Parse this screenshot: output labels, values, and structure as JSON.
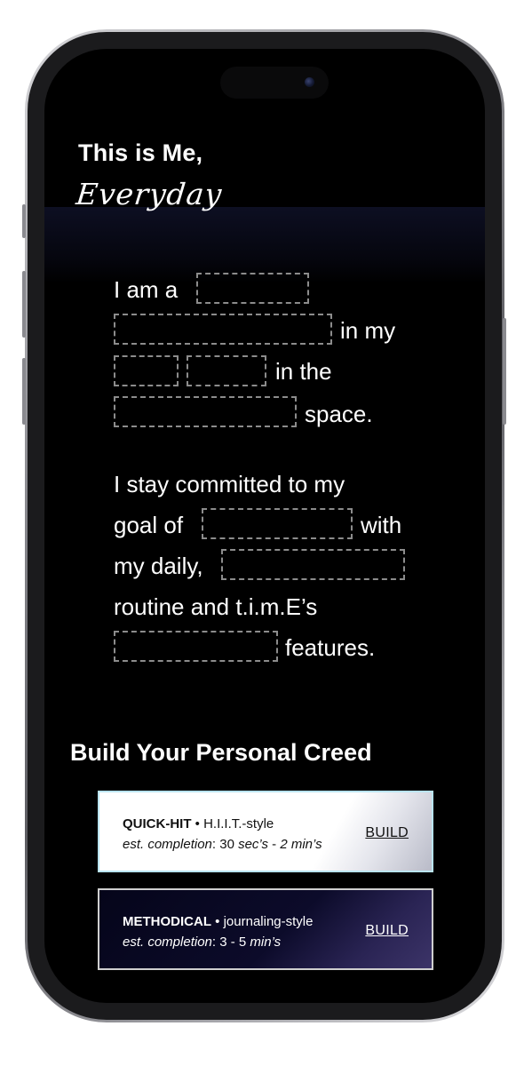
{
  "header": {
    "title": "This is Me,",
    "script_title": "Everyday"
  },
  "creed": {
    "p1": {
      "i_am_a": "I am a",
      "in_my": "in my",
      "in_the": "in the",
      "space": "space."
    },
    "p2": {
      "line1": "I stay committed to my",
      "goal_of": "goal of",
      "with": "with",
      "my_daily": "my daily,",
      "routine": "routine and t.i.m.E’s",
      "features": "features."
    }
  },
  "build_section": {
    "title": "Build Your Personal Creed",
    "cards": [
      {
        "name": "QUICK-HIT",
        "sep": " • ",
        "style": "H.I.I.T.-style",
        "est_label": "est. completion",
        "colon": ": ",
        "est_value_a": "30 ",
        "est_unit_a": "sec’s",
        "est_dash": " - ",
        "est_value_b": "2 min’s",
        "button": "BUILD"
      },
      {
        "name": "METHODICAL",
        "sep": " • ",
        "style": "journaling-style",
        "est_label": "est. completion",
        "colon": ": ",
        "est_value": "3 - 5 ",
        "est_unit": "min’s",
        "button": "BUILD"
      }
    ]
  },
  "colors": {
    "background": "#000000",
    "text": "#ffffff",
    "blank_border": "#8c8c8c",
    "quick_card_border": "#b9e4f0",
    "methodical_card_bg": "#0c0b2a"
  }
}
